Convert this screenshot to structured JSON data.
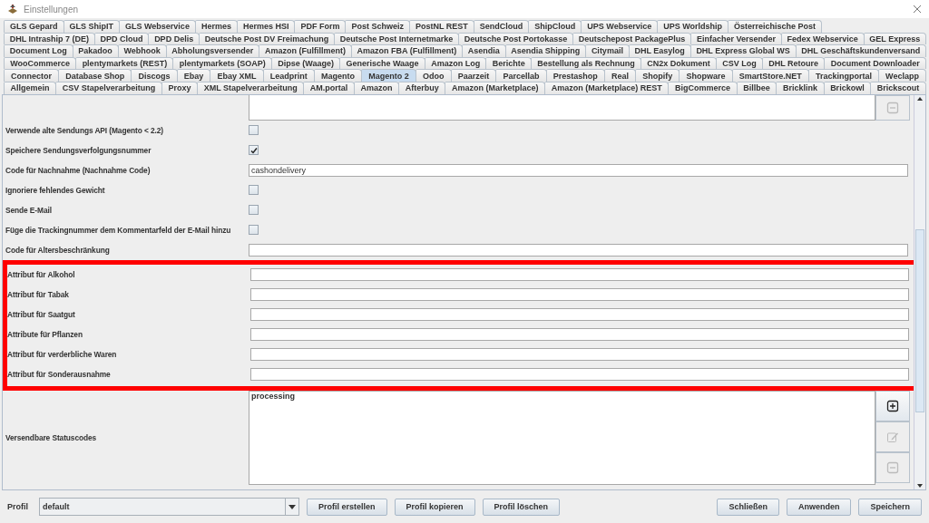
{
  "window": {
    "title": "Einstellungen"
  },
  "tab_rows": [
    [
      {
        "label": "GLS Gepard",
        "selected": false
      },
      {
        "label": "GLS ShipIT",
        "selected": false
      },
      {
        "label": "GLS Webservice",
        "selected": false
      },
      {
        "label": "Hermes",
        "selected": false
      },
      {
        "label": "Hermes HSI",
        "selected": false
      },
      {
        "label": "PDF Form",
        "selected": false
      },
      {
        "label": "Post Schweiz",
        "selected": false
      },
      {
        "label": "PostNL REST",
        "selected": false
      },
      {
        "label": "SendCloud",
        "selected": false
      },
      {
        "label": "ShipCloud",
        "selected": false
      },
      {
        "label": "UPS Webservice",
        "selected": false
      },
      {
        "label": "UPS Worldship",
        "selected": false
      },
      {
        "label": "Österreichische Post",
        "selected": false
      }
    ],
    [
      {
        "label": "DHL Intraship 7 (DE)",
        "selected": false
      },
      {
        "label": "DPD Cloud",
        "selected": false
      },
      {
        "label": "DPD Delis",
        "selected": false
      },
      {
        "label": "Deutsche Post DV Freimachung",
        "selected": false
      },
      {
        "label": "Deutsche Post Internetmarke",
        "selected": false
      },
      {
        "label": "Deutsche Post Portokasse",
        "selected": false
      },
      {
        "label": "Deutschepost PackagePlus",
        "selected": false
      },
      {
        "label": "Einfacher Versender",
        "selected": false
      },
      {
        "label": "Fedex Webservice",
        "selected": false
      },
      {
        "label": "GEL Express",
        "selected": false
      }
    ],
    [
      {
        "label": "Document Log",
        "selected": false
      },
      {
        "label": "Pakadoo",
        "selected": false
      },
      {
        "label": "Webhook",
        "selected": false
      },
      {
        "label": "Abholungsversender",
        "selected": false
      },
      {
        "label": "Amazon (Fulfillment)",
        "selected": false
      },
      {
        "label": "Amazon FBA (Fulfillment)",
        "selected": false
      },
      {
        "label": "Asendia",
        "selected": false
      },
      {
        "label": "Asendia Shipping",
        "selected": false
      },
      {
        "label": "Citymail",
        "selected": false
      },
      {
        "label": "DHL Easylog",
        "selected": false
      },
      {
        "label": "DHL Express Global WS",
        "selected": false
      },
      {
        "label": "DHL Geschäftskundenversand",
        "selected": false
      }
    ],
    [
      {
        "label": "WooCommerce",
        "selected": false
      },
      {
        "label": "plentymarkets (REST)",
        "selected": false
      },
      {
        "label": "plentymarkets (SOAP)",
        "selected": false
      },
      {
        "label": "Dipse (Waage)",
        "selected": false
      },
      {
        "label": "Generische Waage",
        "selected": false
      },
      {
        "label": "Amazon Log",
        "selected": false
      },
      {
        "label": "Berichte",
        "selected": false
      },
      {
        "label": "Bestellung als Rechnung",
        "selected": false
      },
      {
        "label": "CN2x Dokument",
        "selected": false
      },
      {
        "label": "CSV Log",
        "selected": false
      },
      {
        "label": "DHL Retoure",
        "selected": false
      },
      {
        "label": "Document Downloader",
        "selected": false
      }
    ],
    [
      {
        "label": "Connector",
        "selected": false
      },
      {
        "label": "Database Shop",
        "selected": false
      },
      {
        "label": "Discogs",
        "selected": false
      },
      {
        "label": "Ebay",
        "selected": false
      },
      {
        "label": "Ebay XML",
        "selected": false
      },
      {
        "label": "Leadprint",
        "selected": false
      },
      {
        "label": "Magento",
        "selected": false
      },
      {
        "label": "Magento 2",
        "selected": true
      },
      {
        "label": "Odoo",
        "selected": false
      },
      {
        "label": "Paarzeit",
        "selected": false
      },
      {
        "label": "Parcellab",
        "selected": false
      },
      {
        "label": "Prestashop",
        "selected": false
      },
      {
        "label": "Real",
        "selected": false
      },
      {
        "label": "Shopify",
        "selected": false
      },
      {
        "label": "Shopware",
        "selected": false
      },
      {
        "label": "SmartStore.NET",
        "selected": false
      },
      {
        "label": "Trackingportal",
        "selected": false
      },
      {
        "label": "Weclapp",
        "selected": false
      }
    ],
    [
      {
        "label": "Allgemein",
        "selected": false
      },
      {
        "label": "CSV Stapelverarbeitung",
        "selected": false
      },
      {
        "label": "Proxy",
        "selected": false
      },
      {
        "label": "XML Stapelverarbeitung",
        "selected": false
      },
      {
        "label": "AM.portal",
        "selected": false
      },
      {
        "label": "Amazon",
        "selected": false
      },
      {
        "label": "Afterbuy",
        "selected": false
      },
      {
        "label": "Amazon (Marketplace)",
        "selected": false
      },
      {
        "label": "Amazon (Marketplace) REST",
        "selected": false
      },
      {
        "label": "BigCommerce",
        "selected": false
      },
      {
        "label": "Billbee",
        "selected": false
      },
      {
        "label": "Bricklink",
        "selected": false
      },
      {
        "label": "Brickowl",
        "selected": false
      },
      {
        "label": "Brickscout",
        "selected": false
      }
    ]
  ],
  "form_sections": [
    {
      "highlighted": false,
      "rows": [
        {
          "kind": "list-cut",
          "buttons": [
            {
              "kind": "remove",
              "disabled": true
            }
          ]
        },
        {
          "kind": "checkbox",
          "label": "Verwende alte Sendungs API (Magento < 2.2)",
          "checked": false
        },
        {
          "kind": "checkbox",
          "label": "Speichere Sendungsverfolgungsnummer",
          "checked": true
        },
        {
          "kind": "text",
          "label": "Code für Nachnahme (Nachnahme Code)",
          "value": "cashondelivery"
        },
        {
          "kind": "checkbox",
          "label": "Ignoriere fehlendes Gewicht",
          "checked": false
        },
        {
          "kind": "checkbox",
          "label": "Sende E-Mail",
          "checked": false
        },
        {
          "kind": "checkbox",
          "label": "Füge die Trackingnummer dem Kommentarfeld der E-Mail hinzu",
          "checked": false
        },
        {
          "kind": "text",
          "label": "Code für Altersbeschränkung"
        }
      ]
    },
    {
      "highlighted": true,
      "rows": [
        {
          "kind": "text",
          "label": "Attribut für Alkohol"
        },
        {
          "kind": "text",
          "label": "Attribut für Tabak"
        },
        {
          "kind": "text",
          "label": "Attribut für Saatgut"
        },
        {
          "kind": "text",
          "label": "Attribute für Pflanzen"
        },
        {
          "kind": "text",
          "label": "Attribut für verderbliche Waren"
        },
        {
          "kind": "text",
          "label": "Attribut für Sonderausnahme"
        }
      ]
    },
    {
      "highlighted": false,
      "rows": [
        {
          "kind": "list",
          "label": "Versendbare Statuscodes",
          "items": [
            "processing"
          ],
          "buttons": [
            {
              "kind": "add",
              "disabled": false
            },
            {
              "kind": "edit",
              "disabled": true
            },
            {
              "kind": "remove",
              "disabled": true
            }
          ]
        }
      ]
    }
  ],
  "profile": {
    "label": "Profil",
    "value": "default"
  },
  "profile_buttons": [
    "Profil erstellen",
    "Profil kopieren",
    "Profil löschen"
  ],
  "dialog_buttons": [
    "Schließen",
    "Anwenden",
    "Speichern"
  ]
}
